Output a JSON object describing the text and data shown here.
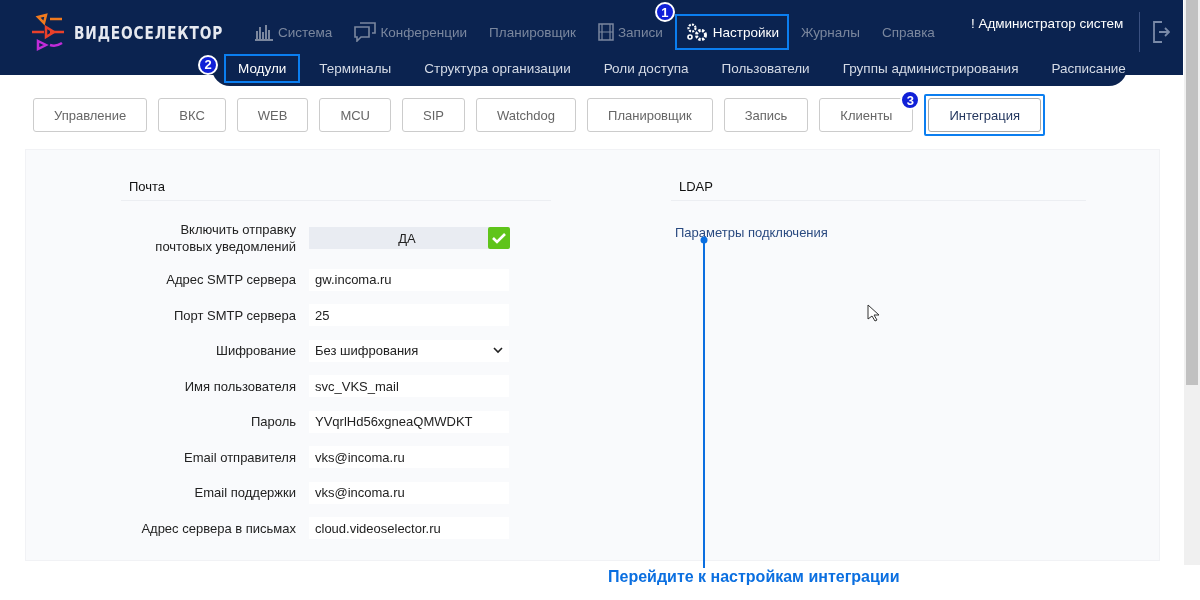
{
  "header": {
    "logo": "ВИДЕОСЕЛЕКТОР",
    "user": "! Администратор систем",
    "nav": [
      {
        "label": "Система",
        "selected": false
      },
      {
        "label": "Конференции",
        "selected": false
      },
      {
        "label": "Планировщик",
        "selected": false
      },
      {
        "label": "Записи",
        "selected": false
      },
      {
        "label": "Настройки",
        "selected": true,
        "callout": "1"
      },
      {
        "label": "Журналы",
        "selected": false
      },
      {
        "label": "Справка",
        "selected": false
      }
    ],
    "subnav": [
      {
        "label": "Модули",
        "selected": true,
        "callout": "2"
      },
      {
        "label": "Терминалы",
        "selected": false
      },
      {
        "label": "Структура организации",
        "selected": false
      },
      {
        "label": "Роли доступа",
        "selected": false
      },
      {
        "label": "Пользователи",
        "selected": false
      },
      {
        "label": "Группы администрирования",
        "selected": false
      },
      {
        "label": "Расписание",
        "selected": false
      }
    ]
  },
  "tabs": [
    {
      "label": "Управление",
      "selected": false
    },
    {
      "label": "ВКС",
      "selected": false
    },
    {
      "label": "WEB",
      "selected": false
    },
    {
      "label": "MCU",
      "selected": false
    },
    {
      "label": "SIP",
      "selected": false
    },
    {
      "label": "Watchdog",
      "selected": false
    },
    {
      "label": "Планировщик",
      "selected": false
    },
    {
      "label": "Запись",
      "selected": false
    },
    {
      "label": "Клиенты",
      "selected": false
    },
    {
      "label": "Интеграция",
      "selected": true,
      "callout": "3"
    }
  ],
  "mail": {
    "title": "Почта",
    "fields": [
      {
        "kind": "toggle",
        "label": "Включить отправку почтовых уведомлений",
        "value": "ДА",
        "on": true
      },
      {
        "kind": "text",
        "label": "Адрес SMTP сервера",
        "value": "gw.incoma.ru"
      },
      {
        "kind": "text",
        "label": "Порт SMTP сервера",
        "value": "25"
      },
      {
        "kind": "select",
        "label": "Шифрование",
        "value": "Без шифрования"
      },
      {
        "kind": "text",
        "label": "Имя пользователя",
        "value": "svc_VKS_mail"
      },
      {
        "kind": "text",
        "label": "Пароль",
        "value": "YVqrlHd56xgneaQMWDKT"
      },
      {
        "kind": "text",
        "label": "Email отправителя",
        "value": "vks@incoma.ru"
      },
      {
        "kind": "text",
        "label": "Email поддержки",
        "value": "vks@incoma.ru"
      },
      {
        "kind": "text",
        "label": "Адрес сервера в письмах",
        "value": "cloud.videoselector.ru"
      }
    ]
  },
  "ldap": {
    "title": "LDAP",
    "link": "Параметры подключения"
  },
  "annotation": "Перейдите к настройкам интеграции"
}
